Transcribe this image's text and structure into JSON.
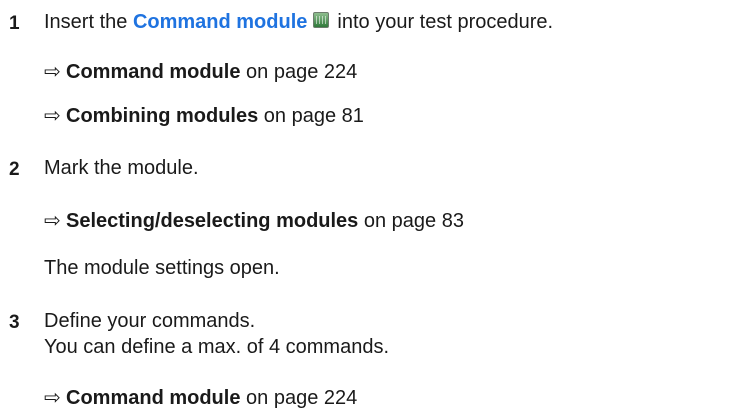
{
  "steps": [
    {
      "number": "1",
      "text_before": "Insert the ",
      "keyword": "Command module",
      "icon": "command-module-icon",
      "text_after": "into your test procedure.",
      "refs": [
        {
          "arrow": "⇨",
          "title": "Command module",
          "page": "on page 224"
        },
        {
          "arrow": "⇨",
          "title": "Combining modules",
          "page": "on page 81"
        }
      ]
    },
    {
      "number": "2",
      "text": "Mark the module.",
      "refs": [
        {
          "arrow": "⇨",
          "title": "Selecting/deselecting modules",
          "page": "on page 83"
        }
      ],
      "result": "The module settings open."
    },
    {
      "number": "3",
      "text": "Define your commands.",
      "text_line2": "You can define a max. of 4 commands.",
      "refs": [
        {
          "arrow": "⇨",
          "title": "Command module",
          "page": "on page 224"
        }
      ]
    }
  ],
  "colors": {
    "keyword": "#1f73e0",
    "text": "#1a1a1a"
  }
}
